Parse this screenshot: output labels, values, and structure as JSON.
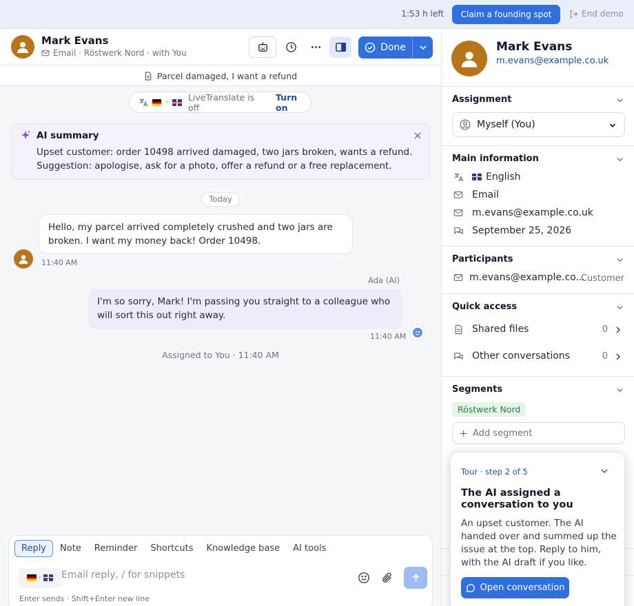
{
  "topbar": {
    "time_left": "1:53 h left",
    "claim_label": "Claim a founding spot",
    "end_demo_label": "End demo"
  },
  "conversation": {
    "contact_name": "Mark Evans",
    "meta": "Email · Röstwerk Nord · with You",
    "done_label": "Done",
    "subject": "Parcel damaged, I want a refund",
    "livetranslate_status": "LiveTranslate is off",
    "livetranslate_action": "Turn on",
    "ai_summary": {
      "title": "AI summary",
      "line1": "Upset customer: order 10498 arrived damaged, two jars broken, wants a refund.",
      "line2": "Suggestion: apologise, ask for a photo, offer a refund or a free replacement."
    },
    "day_divider": "Today",
    "messages": [
      {
        "text": "Hello, my parcel arrived completely crushed and two jars are broken. I want my money back! Order 10498.",
        "time": "11:40 AM"
      },
      {
        "sender": "Ada (AI)",
        "text": "I'm so sorry, Mark! I'm passing you straight to a colleague who will sort this out right away.",
        "time": "11:40 AM"
      }
    ],
    "system_note": "Assigned to You · 11:40 AM"
  },
  "composer": {
    "tabs": [
      "Reply",
      "Note",
      "Reminder",
      "Shortcuts",
      "Knowledge base",
      "AI tools"
    ],
    "placeholder": "Email reply, / for snippets",
    "hint": "Enter sends · Shift+Enter new line"
  },
  "sidebar": {
    "name": "Mark Evans",
    "email": "m.evans@example.co.uk",
    "assignment": {
      "title": "Assignment",
      "value": "Myself (You)"
    },
    "main_info": {
      "title": "Main information",
      "language": "English",
      "channel": "Email",
      "email": "m.evans@example.co.uk",
      "date": "September 25, 2026"
    },
    "participants": {
      "title": "Participants",
      "email": "m.evans@example.co...",
      "role": "Customer"
    },
    "quick_access": {
      "title": "Quick access",
      "items": [
        {
          "label": "Shared files",
          "count": "0"
        },
        {
          "label": "Other conversations",
          "count": "0"
        }
      ]
    },
    "segments": {
      "title": "Segments",
      "chip": "Röstwerk Nord",
      "add_label": "Add segment"
    }
  },
  "tour": {
    "step": "Tour · step 2 of 5",
    "title": "The AI assigned a conversation to you",
    "body": "An upset customer. The AI handed over and summed up the issue at the top. Reply to him, with the AI draft if you like.",
    "button": "Open conversation"
  },
  "colors": {
    "primary": "#2f6fde",
    "avatar": "#b8741a",
    "ai_bubble": "#eeecf9",
    "segment_chip": "#e6f4ea"
  }
}
